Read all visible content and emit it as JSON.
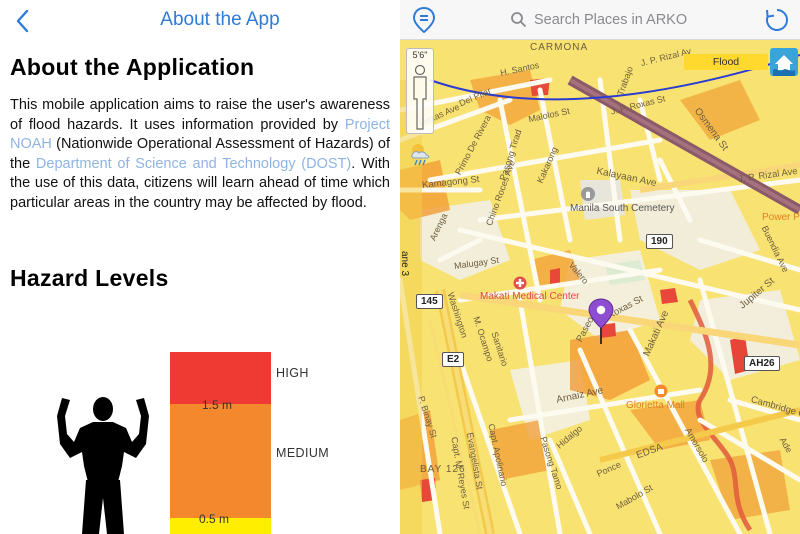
{
  "about": {
    "nav_title": "About the App",
    "heading": "About the Application",
    "desc_part1": "This mobile application aims to raise the user's awareness of flood hazards. It uses information provided by ",
    "link_noah": "Project NOAH",
    "desc_part2": " (Nationwide Operational Assessment of Hazards) of the ",
    "link_dost": "Department of Science and Technology (DOST)",
    "desc_part3": ". With the use of this data, citizens will learn ahead of time which particular areas in the country may be affected by flood.",
    "hazard_heading": "Hazard Levels",
    "levels": {
      "high": "HIGH",
      "medium": "MEDIUM"
    },
    "marks": {
      "m15": "1.5 m",
      "m05": "0.5 m"
    },
    "colors": {
      "high": "#ee3a33",
      "medium": "#f3882d",
      "low": "#ffee00",
      "link": "#8fb4e3",
      "nav": "#2f7bd8"
    }
  },
  "map": {
    "search_placeholder": "Search Places in ARKO",
    "layer_label": "Flood",
    "person_height": "5'6\"",
    "streets": {
      "carmona": "CARMONA",
      "jp_rizal_top": "J. P. Rizal Av",
      "h_santos": "H. Santos",
      "trabajo": "Trabajo",
      "roxas_ave": "Roxas Ave",
      "del_pilar": "Del Pilar",
      "primo_rivera": "Primo De Rivera",
      "malolos": "Malolos St",
      "jp_roxas": "J. P. Roxas St",
      "osmena": "Osmena St",
      "kalayaan": "Kalayaan Ave",
      "kamagong": "Kamagong St",
      "chino_roces": "Chino Roces Ave",
      "pasong_tirad": "Pasong Tirad",
      "kakarong": "Kakarong",
      "jp_rizal_right": "J. P. Rizal Ave",
      "arenga": "Arenga",
      "malugay": "Malugay St",
      "valero": "Valero",
      "buendia": "Buendia Ave",
      "jupiter": "Jupiter St",
      "washington": "Washington",
      "m_ocampo": "M. Ocampo",
      "paseo": "Paseo",
      "roxas_st": "Roxas St",
      "makati_ave": "Makati Ave",
      "arnaiz": "Arnaiz Ave",
      "edsa": "EDSA",
      "p_binay": "P. Binay St",
      "hidalgo": "Hidalgo",
      "pasong_tamo": "Pasong Tamo",
      "ponce": "Ponce",
      "mabolo": "Mabolo St",
      "capt_apolinario": "Capt. Apolinario",
      "evangelista": "Evangelista St",
      "m_reyes": "Capt. M. Reyes St",
      "amorsolo": "Amorsolo",
      "cambridge": "Cambridge Ci",
      "sanitario": "Sanitario",
      "ade": "Ade",
      "bay126": "BAY 126",
      "skyway": "ane 3"
    },
    "pois": {
      "manila_south": "Manila South Cemetery",
      "makati_medical": "Makati Medical Center",
      "glorietta": "Glorietta Mall",
      "power_plant": "Power Pl"
    },
    "shields": {
      "s190": "190",
      "s145": "145",
      "e2": "E2",
      "ah26": "AH26"
    }
  }
}
